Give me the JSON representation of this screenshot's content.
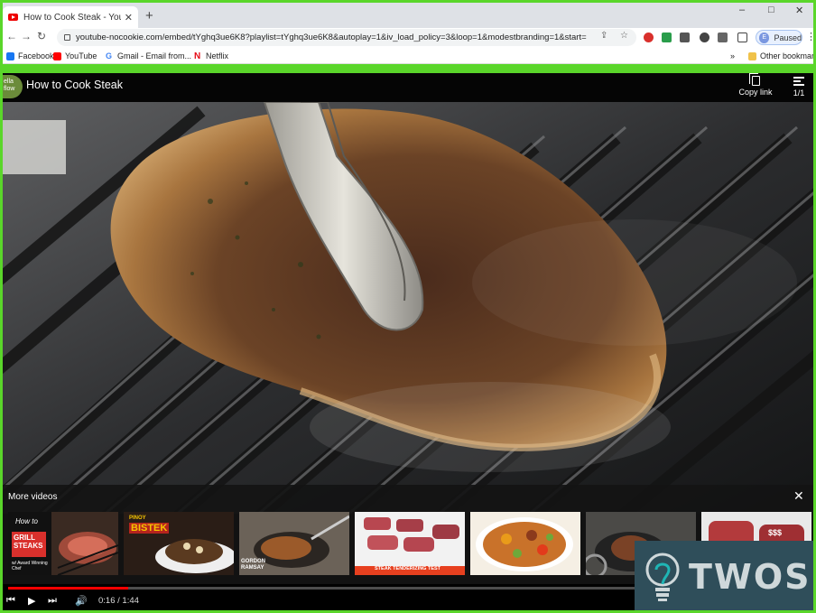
{
  "browser": {
    "tab_title": "How to Cook Steak - YouTube",
    "tab_close": "✕",
    "new_tab": "+",
    "url": "youtube-nocookie.com/embed/tYghq3ue6K8?playlist=tYghq3ue6K8&autoplay=1&iv_load_policy=3&loop=1&modestbranding=1&start=",
    "profile_initial": "E",
    "profile_status": "Paused",
    "window_controls": [
      "–",
      "□",
      "✕"
    ]
  },
  "bookmarks": {
    "items": [
      {
        "label": "Facebook",
        "color": "#1877f2"
      },
      {
        "label": "YouTube",
        "color": "#ff0000"
      },
      {
        "label": "Gmail - Email from...",
        "color": "#ea4335"
      },
      {
        "label": "Netflix",
        "color": "#e50914"
      }
    ],
    "overflow": "»",
    "other": "Other bookmarks"
  },
  "player": {
    "channel_logo_text": "ella\nflow",
    "title": "How to Cook Steak",
    "copy_link_label": "Copy link",
    "playlist_count": "1/1",
    "more_videos_title": "More videos",
    "more_close": "✕",
    "thumbnails": [
      {
        "text_top": "How to",
        "text_main": "GRILL STEAKS",
        "text_sub": "w/ Award Winning Chef"
      },
      {
        "text_top": "PINOY",
        "text_main": "BISTEK"
      },
      {
        "text_main": "GORDON RAMSAY"
      },
      {
        "text_main": "STEAK TENDERIZING TEST"
      },
      {
        "text_main": ""
      },
      {
        "text_main": ""
      },
      {
        "text_main": "$$$"
      }
    ],
    "time_current": "0:16",
    "time_total": "1:44",
    "progress_fraction": 0.15
  },
  "watermark": {
    "text": "TWOS"
  },
  "colors": {
    "frame_green": "#5ad62a",
    "progress_red": "#ff0000"
  }
}
